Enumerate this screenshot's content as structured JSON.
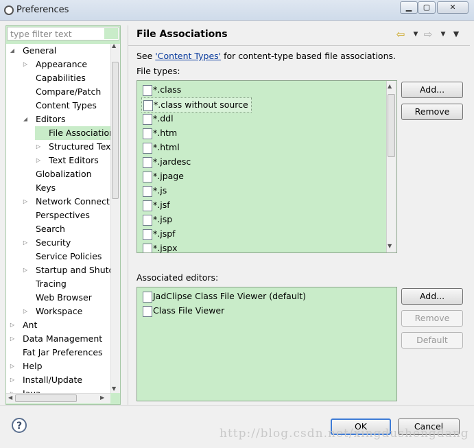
{
  "window": {
    "title": "Preferences"
  },
  "filter": {
    "placeholder": "type filter text"
  },
  "tree": {
    "items": [
      {
        "label": "General",
        "depth": 0,
        "twisty": "open"
      },
      {
        "label": "Appearance",
        "depth": 1,
        "twisty": "closed"
      },
      {
        "label": "Capabilities",
        "depth": 1,
        "twisty": ""
      },
      {
        "label": "Compare/Patch",
        "depth": 1,
        "twisty": ""
      },
      {
        "label": "Content Types",
        "depth": 1,
        "twisty": ""
      },
      {
        "label": "Editors",
        "depth": 1,
        "twisty": "open"
      },
      {
        "label": "File Associations",
        "depth": 2,
        "twisty": "",
        "selected": true
      },
      {
        "label": "Structured Text",
        "depth": 2,
        "twisty": "closed"
      },
      {
        "label": "Text Editors",
        "depth": 2,
        "twisty": "closed"
      },
      {
        "label": "Globalization",
        "depth": 1,
        "twisty": ""
      },
      {
        "label": "Keys",
        "depth": 1,
        "twisty": ""
      },
      {
        "label": "Network Connections",
        "depth": 1,
        "twisty": "closed"
      },
      {
        "label": "Perspectives",
        "depth": 1,
        "twisty": ""
      },
      {
        "label": "Search",
        "depth": 1,
        "twisty": ""
      },
      {
        "label": "Security",
        "depth": 1,
        "twisty": "closed"
      },
      {
        "label": "Service Policies",
        "depth": 1,
        "twisty": ""
      },
      {
        "label": "Startup and Shutdown",
        "depth": 1,
        "twisty": "closed"
      },
      {
        "label": "Tracing",
        "depth": 1,
        "twisty": ""
      },
      {
        "label": "Web Browser",
        "depth": 1,
        "twisty": ""
      },
      {
        "label": "Workspace",
        "depth": 1,
        "twisty": "closed"
      },
      {
        "label": "Ant",
        "depth": 0,
        "twisty": "closed"
      },
      {
        "label": "Data Management",
        "depth": 0,
        "twisty": "closed"
      },
      {
        "label": "Fat Jar Preferences",
        "depth": 0,
        "twisty": ""
      },
      {
        "label": "Help",
        "depth": 0,
        "twisty": "closed"
      },
      {
        "label": "Install/Update",
        "depth": 0,
        "twisty": "closed"
      },
      {
        "label": "Java",
        "depth": 0,
        "twisty": "closed"
      }
    ]
  },
  "page": {
    "title": "File Associations",
    "see_prefix": "See ",
    "see_link": "'Content Types'",
    "see_suffix": " for content-type based file associations.",
    "file_types_label": "File types:",
    "file_types": [
      {
        "label": "*.class",
        "icon": "class-file-icon"
      },
      {
        "label": "*.class without source",
        "icon": "class-file-icon",
        "selected": true
      },
      {
        "label": "*.ddl",
        "icon": "ddl-file-icon"
      },
      {
        "label": "*.htm",
        "icon": "html-file-icon"
      },
      {
        "label": "*.html",
        "icon": "html-file-icon"
      },
      {
        "label": "*.jardesc",
        "icon": "jardesc-file-icon"
      },
      {
        "label": "*.jpage",
        "icon": "jpage-file-icon"
      },
      {
        "label": "*.js",
        "icon": "js-file-icon"
      },
      {
        "label": "*.jsf",
        "icon": "text-file-icon"
      },
      {
        "label": "*.jsp",
        "icon": "text-file-icon"
      },
      {
        "label": "*.jspf",
        "icon": "text-file-icon"
      },
      {
        "label": "*.jspx",
        "icon": "text-file-icon"
      }
    ],
    "add_label": "Add...",
    "remove_label": "Remove",
    "editors_label": "Associated editors:",
    "editors": [
      {
        "label": "JadClipse Class File Viewer (default)",
        "icon": "class-file-icon"
      },
      {
        "label": "Class File Viewer",
        "icon": "class-file-icon"
      }
    ],
    "add2_label": "Add...",
    "remove2_label": "Remove",
    "default_label": "Default"
  },
  "footer": {
    "ok_label": "OK",
    "cancel_label": "Cancel",
    "watermark": "http://blog.csdn.net/xingdushengdang"
  },
  "colors": {
    "list_bg": "#c9ecc9",
    "link": "#0b3c9e"
  }
}
